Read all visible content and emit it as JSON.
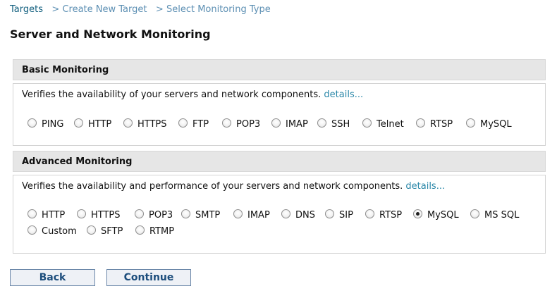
{
  "breadcrumb": {
    "items": [
      "Targets",
      "Create New Target",
      "Select Monitoring Type"
    ],
    "separator": ">"
  },
  "page_title": "Server and Network Monitoring",
  "basic": {
    "title": "Basic Monitoring",
    "description": "Verifies the availability of your servers and network components.",
    "details_link": "details...",
    "options": [
      "PING",
      "HTTP",
      "HTTPS",
      "FTP",
      "POP3",
      "IMAP",
      "SSH",
      "Telnet",
      "RTSP",
      "MySQL"
    ],
    "selected": null
  },
  "advanced": {
    "title": "Advanced Monitoring",
    "description": "Verifies the availability and performance of your servers and network components.",
    "details_link": "details...",
    "options": [
      "HTTP",
      "HTTPS",
      "POP3",
      "SMTP",
      "IMAP",
      "DNS",
      "SIP",
      "RTSP",
      "MySQL",
      "MS SQL",
      "Custom",
      "SFTP",
      "RTMP"
    ],
    "selected": "MySQL"
  },
  "buttons": {
    "back": "Back",
    "continue": "Continue"
  },
  "colors": {
    "link": "#1a6b9a",
    "details_link": "#2a87a8",
    "section_header_bg": "#e6e6e6",
    "button_text": "#1c4d7c",
    "button_border": "#6a86a8"
  }
}
